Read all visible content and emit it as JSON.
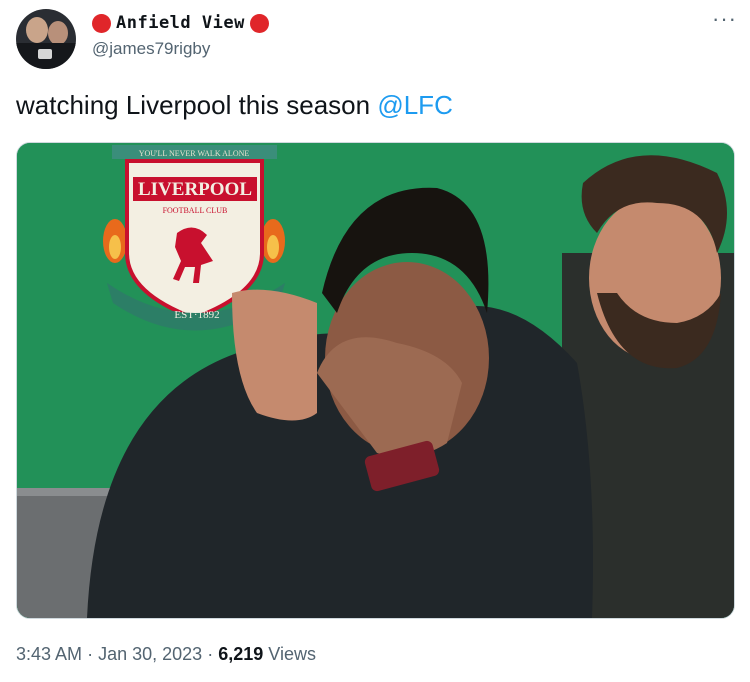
{
  "author": {
    "display_name": "Anfield View",
    "handle": "@james79rigby",
    "badge_color": "#e0262a"
  },
  "tweet": {
    "text": "watching Liverpool this season ",
    "mention": "@LFC"
  },
  "media": {
    "crest_banner": "YOU'LL NEVER WALK ALONE",
    "crest_title": "LIVERPOOL",
    "crest_subtitle": "FOOTBALL CLUB",
    "crest_est": "EST·1892"
  },
  "meta": {
    "time": "3:43 AM",
    "separator": "·",
    "date": "Jan 30, 2023",
    "views_count": "6,219",
    "views_label": "Views"
  },
  "icons": {
    "more": "more-horizontal-icon"
  },
  "colors": {
    "link": "#1d9bf0",
    "secondary_text": "#536471",
    "primary_text": "#0f1419"
  }
}
